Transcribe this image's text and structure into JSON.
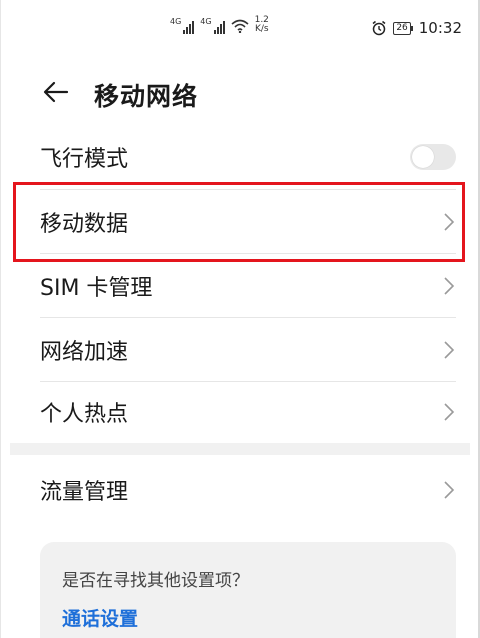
{
  "status_bar": {
    "signal_1_label": "4G",
    "signal_2_label": "4G",
    "network_speed_value": "1.2",
    "network_speed_unit": "K/s",
    "battery_level": "26",
    "time": "10:32"
  },
  "header": {
    "title": "移动网络",
    "back_icon": "arrow-left-icon"
  },
  "settings": {
    "airplane_mode": {
      "label": "飞行模式",
      "enabled": false
    },
    "items": [
      {
        "label": "移动数据",
        "icon": "chevron-right-icon",
        "highlighted": true
      },
      {
        "label": "SIM 卡管理",
        "icon": "chevron-right-icon"
      },
      {
        "label": "网络加速",
        "icon": "chevron-right-icon"
      },
      {
        "label": "个人热点",
        "icon": "chevron-right-icon"
      }
    ],
    "traffic": {
      "label": "流量管理",
      "icon": "chevron-right-icon"
    }
  },
  "suggestion": {
    "question": "是否在寻找其他设置项？",
    "link": "通话设置"
  },
  "colors": {
    "highlight_border": "#e4151d",
    "link": "#1e6fd9",
    "card_background": "#f1f1f1"
  }
}
